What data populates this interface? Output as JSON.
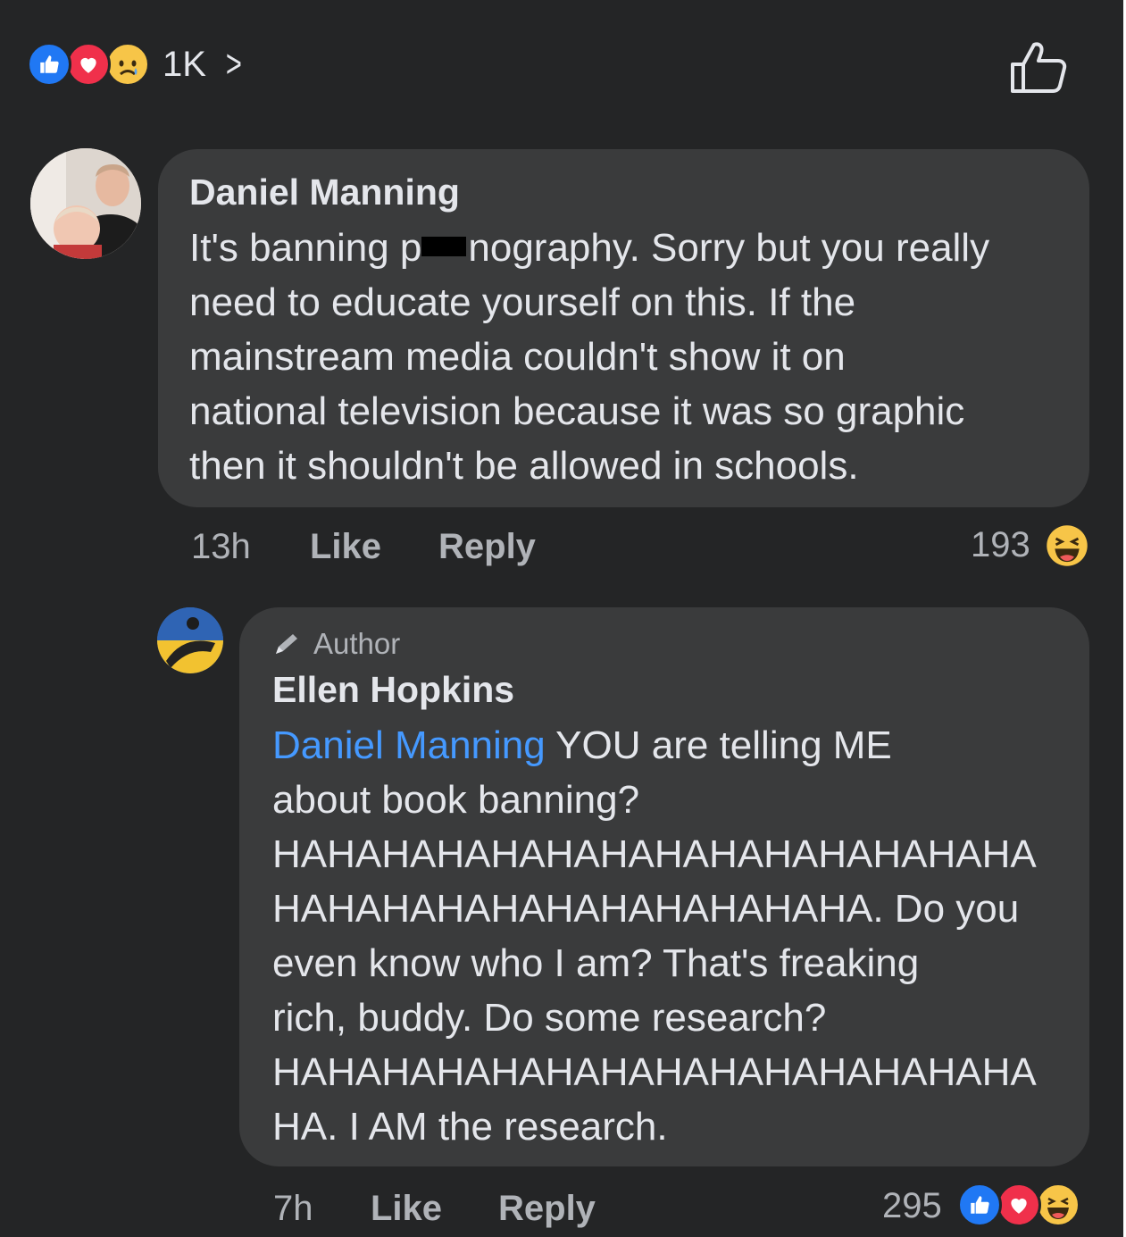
{
  "post": {
    "reaction_count": "1K",
    "reaction_icons": [
      "like-icon",
      "love-icon",
      "sad-icon"
    ],
    "like_icon": "thumbs-up-outline-icon"
  },
  "comments": [
    {
      "author": "Daniel Manning",
      "text_lines": [
        "It's banning p",
        "nography. Sorry but you really",
        "need to educate yourself on this. If the",
        "mainstream media couldn't show it on",
        "national television because it was so graphic",
        "then it shouldn't be allowed in schools."
      ],
      "time": "13h",
      "like_label": "Like",
      "reply_label": "Reply",
      "reaction_count": "193",
      "reaction_icons": [
        "haha-icon"
      ]
    },
    {
      "badge": "Author",
      "author": "Ellen Hopkins",
      "mention": "Daniel Manning",
      "text_lines": [
        " YOU are telling ME",
        "about book banning?",
        "HAHAHAHAHAHAHAHAHAHAHAHAHAHA",
        "HAHAHAHAHAHAHAHAHAHAHA. Do you",
        "even know who I am? That's freaking",
        "rich, buddy. Do some research?",
        "HAHAHAHAHAHAHAHAHAHAHAHAHAHA",
        "HA. I AM the research."
      ],
      "time": "7h",
      "like_label": "Like",
      "reply_label": "Reply",
      "reaction_count": "295",
      "reaction_icons": [
        "like-icon",
        "love-icon",
        "haha-icon"
      ]
    }
  ],
  "colors": {
    "background": "#242526",
    "bubble": "#3a3b3c",
    "text": "#e4e6eb",
    "secondary_text": "#b0b3b8",
    "mention": "#4599ff",
    "like_blue": "#2078f4",
    "love_red": "#f0304b",
    "haha_yellow": "#f7c548"
  }
}
